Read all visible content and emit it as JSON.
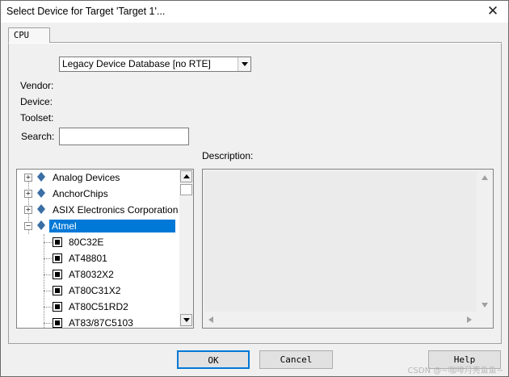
{
  "window": {
    "title": "Select Device for Target 'Target 1'...",
    "close_glyph": "✕"
  },
  "tabs": [
    {
      "label": "CPU",
      "active": true
    }
  ],
  "database_select": {
    "value": "Legacy Device Database [no RTE]"
  },
  "labels": {
    "vendor": "Vendor:",
    "device": "Device:",
    "toolset": "Toolset:",
    "search": "Search:",
    "description": "Description:"
  },
  "search": {
    "value": ""
  },
  "tree": {
    "vendors": [
      {
        "name": "Analog Devices",
        "expanded": false,
        "icon": "vendor-diamond-icon"
      },
      {
        "name": "AnchorChips",
        "expanded": false,
        "icon": "vendor-diamond-icon"
      },
      {
        "name": "ASIX Electronics Corporation",
        "expanded": false,
        "icon": "vendor-diamond-icon"
      },
      {
        "name": "Atmel",
        "expanded": true,
        "selected": true,
        "icon": "vendor-diamond-icon"
      }
    ],
    "devices": [
      "80C32E",
      "AT48801",
      "AT8032X2",
      "AT80C31X2",
      "AT80C51RD2",
      "AT83/87C5103"
    ]
  },
  "buttons": {
    "ok": "OK",
    "cancel": "Cancel",
    "help": "Help"
  },
  "watermark": "CSDN @~咖啡月亮鱼鱼~",
  "colors": {
    "selection": "#0078d7",
    "diamond": "#3a6ea5"
  }
}
